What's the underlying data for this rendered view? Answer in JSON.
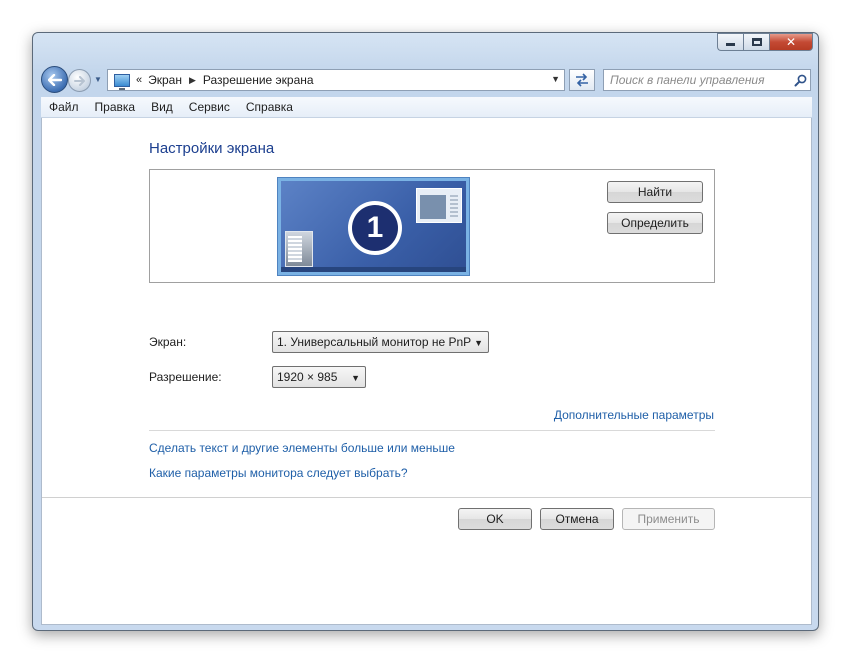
{
  "window": {
    "caption_buttons": [
      "minimize",
      "maximize",
      "close"
    ]
  },
  "address": {
    "overflow_marker": "«",
    "breadcrumbs": [
      "Экран",
      "Разрешение экрана"
    ]
  },
  "search": {
    "placeholder": "Поиск в панели управления"
  },
  "menu": {
    "items": [
      "Файл",
      "Правка",
      "Вид",
      "Сервис",
      "Справка"
    ]
  },
  "main": {
    "title": "Настройки экрана",
    "monitor_number": "1",
    "find_button": "Найти",
    "identify_button": "Определить",
    "display_label": "Экран:",
    "display_value": "1. Универсальный монитор не PnP",
    "resolution_label": "Разрешение:",
    "resolution_value": "1920 × 985",
    "advanced_link": "Дополнительные параметры",
    "text_size_link": "Сделать текст и другие элементы больше или меньше",
    "which_settings_link": "Какие параметры монитора следует выбрать?"
  },
  "footer": {
    "ok": "OK",
    "cancel": "Отмена",
    "apply": "Применить",
    "apply_enabled": false
  },
  "colors": {
    "title_blue": "#1c3f8f",
    "link_blue": "#1f5fa8",
    "close_red": "#c44a34",
    "monitor_blue": "#3a5fa8"
  }
}
